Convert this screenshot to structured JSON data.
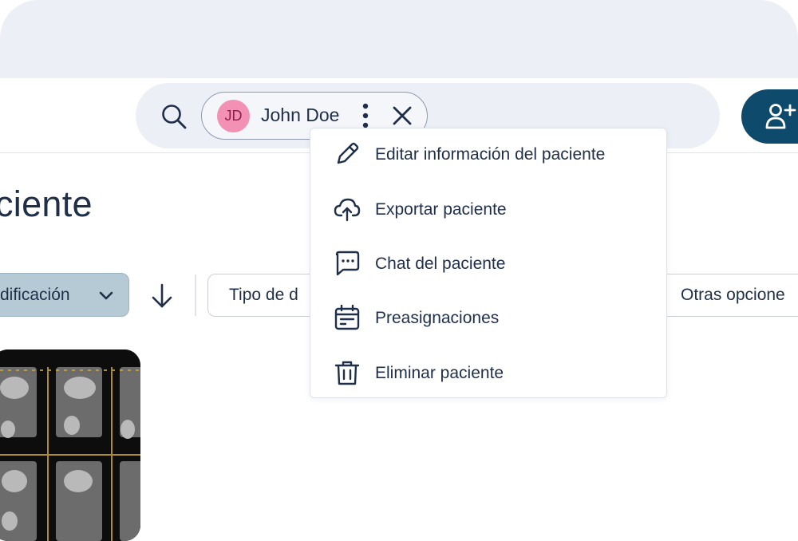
{
  "search": {
    "patient_chip": {
      "initials": "JD",
      "name": "John Doe"
    }
  },
  "page": {
    "title": "ciente"
  },
  "toolbar": {
    "sort_label": "dificación",
    "filter_type_label": "Tipo de d",
    "other_options_label": "Otras opcione"
  },
  "context_menu": {
    "items": [
      {
        "label": "Editar información del paciente",
        "icon": "pencil-icon"
      },
      {
        "label": "Exportar paciente",
        "icon": "cloud-upload-icon"
      },
      {
        "label": "Chat del paciente",
        "icon": "chat-bubble-icon"
      },
      {
        "label": "Preasignaciones",
        "icon": "calendar-icon"
      },
      {
        "label": "Eliminar paciente",
        "icon": "trash-icon"
      }
    ]
  },
  "colors": {
    "primary": "#0d4a6b",
    "text": "#1f2f4a",
    "avatar_bg": "#f291b3",
    "sort_bg": "#b6cad6",
    "search_bg": "#eceff6"
  }
}
